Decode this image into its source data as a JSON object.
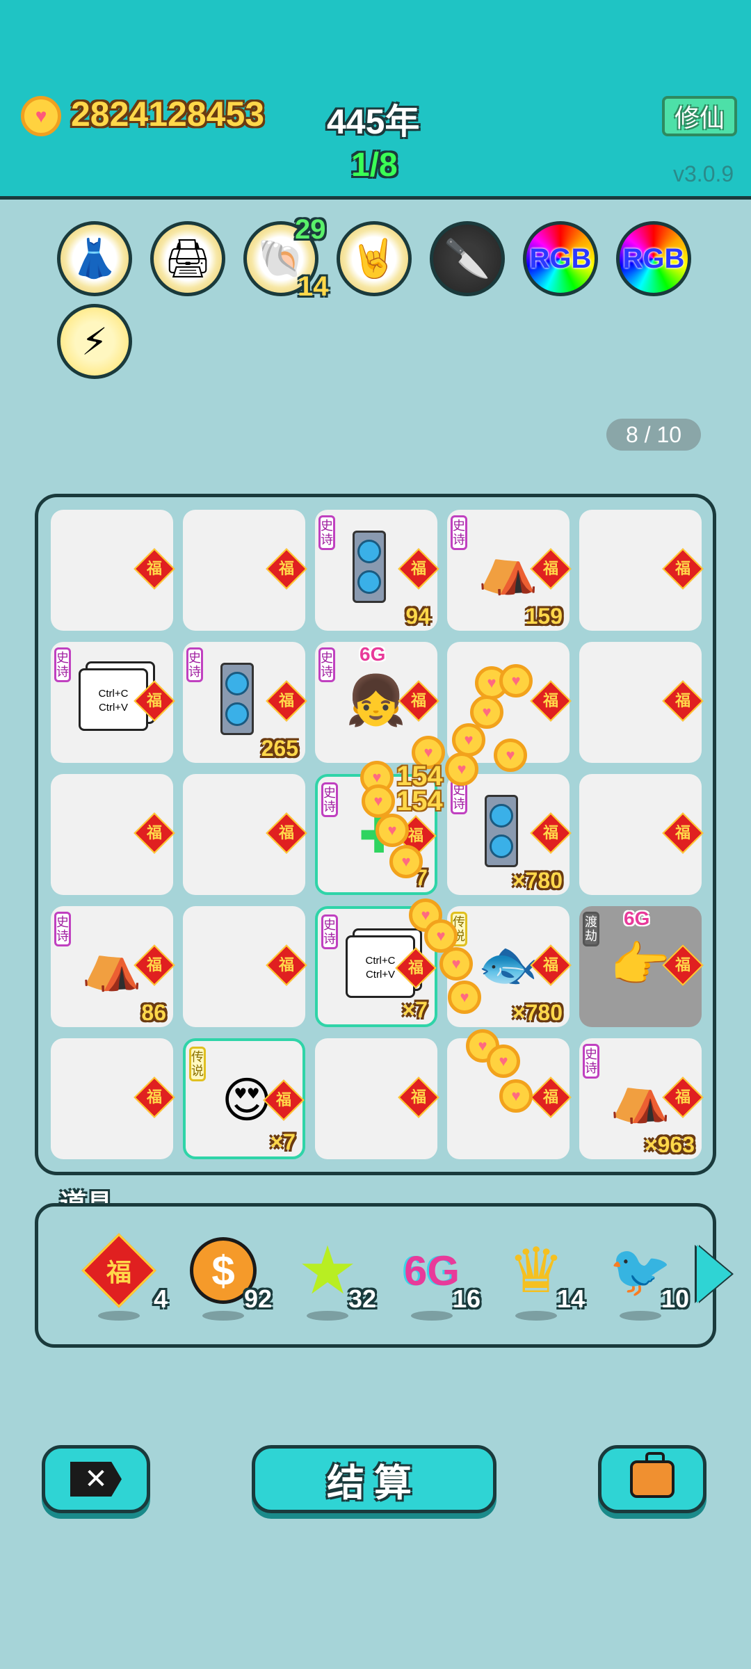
{
  "header": {
    "coins": "2824128453",
    "year": "445年",
    "round": "1/8",
    "mode_button": "修仙",
    "version": "v3.0.9"
  },
  "relics": [
    {
      "name": "pleated-skirt",
      "glyph": "👗"
    },
    {
      "name": "printer",
      "glyph": "🖨"
    },
    {
      "name": "shell",
      "glyph": "🐚",
      "top_count": "29",
      "bottom_count": "14"
    },
    {
      "name": "rock-hand",
      "glyph": "🤘"
    },
    {
      "name": "cleaver",
      "glyph": "🔪"
    },
    {
      "name": "rgb-orb-1",
      "label": "RGB"
    },
    {
      "name": "rgb-orb-2",
      "label": "RGB"
    },
    {
      "name": "lightning",
      "glyph": "⚡"
    }
  ],
  "slot_counter": "8 / 10",
  "fu_char": "福",
  "board": {
    "cells": [
      {
        "num": ""
      },
      {
        "num": ""
      },
      {
        "tag": "史诗",
        "num": "94"
      },
      {
        "tag": "史诗",
        "num": "159"
      },
      {
        "num": ""
      },
      {
        "tag": "史诗",
        "ctrl_text": [
          "Ctrl+C",
          "Ctrl+V"
        ],
        "num": ""
      },
      {
        "tag": "史诗",
        "num": "265"
      },
      {
        "tag": "史诗",
        "badge": "6G",
        "num": ""
      },
      {
        "num": ""
      },
      {
        "num": ""
      },
      {
        "num": ""
      },
      {
        "num": ""
      },
      {
        "tag": "史诗",
        "num": "7"
      },
      {
        "tag": "史诗",
        "num": "×780"
      },
      {
        "num": ""
      },
      {
        "tag": "史诗",
        "num": "86"
      },
      {
        "num": ""
      },
      {
        "tag": "史诗",
        "ctrl_text": [
          "Ctrl+C",
          "Ctrl+V"
        ],
        "num": "×7"
      },
      {
        "tag": "传说",
        "num": "×780"
      },
      {
        "tag": "渡劫",
        "badge": "6G",
        "num": ""
      },
      {
        "num": ""
      },
      {
        "tag": "传说",
        "num": "×7"
      },
      {
        "num": ""
      },
      {
        "num": ""
      },
      {
        "tag": "史诗",
        "num": "×963"
      }
    ],
    "floating_numbers": [
      "154",
      "154"
    ]
  },
  "props": {
    "title": "道具",
    "items": [
      {
        "name": "fu-token",
        "glyph": "福",
        "count": "4"
      },
      {
        "name": "dollar-coin",
        "glyph": "$",
        "count": "92"
      },
      {
        "name": "star",
        "glyph": "★",
        "count": "32"
      },
      {
        "name": "6g",
        "glyph": "6G",
        "count": "16"
      },
      {
        "name": "crown",
        "glyph": "♛",
        "count": "14"
      },
      {
        "name": "bird",
        "glyph": "🐦",
        "count": "10"
      }
    ]
  },
  "buttons": {
    "settle": "结算"
  }
}
